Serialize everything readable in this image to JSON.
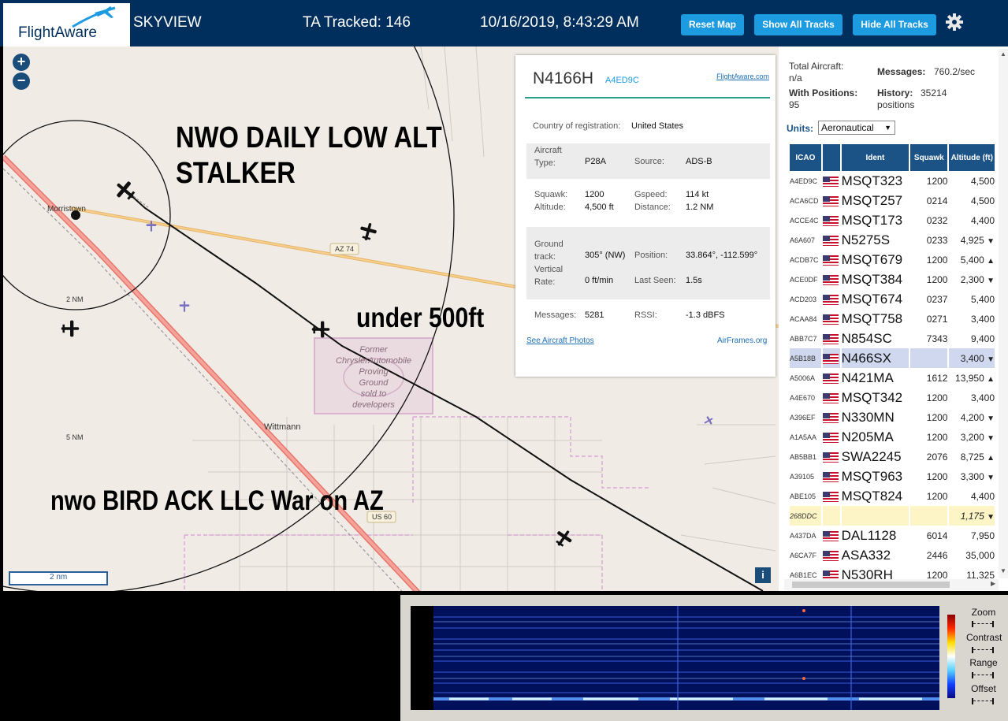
{
  "topbar": {
    "logo_text": "FlightAware",
    "app_name": "SKYVIEW",
    "tracked": "TA Tracked: 146",
    "datetime": "10/16/2019, 8:43:29 AM",
    "buttons": {
      "reset": "Reset Map",
      "show_all": "Show All Tracks",
      "hide_all": "Hide All Tracks"
    },
    "colors": {
      "bar": "#002f5d",
      "button": "#1c9be1"
    }
  },
  "map": {
    "zoom_in": "+",
    "zoom_out": "−",
    "annotations": {
      "line1": "NWO DAILY LOW ALT",
      "line2": "STALKER",
      "under": "under 500ft",
      "bottom": "nwo BIRD ACK LLC War on AZ"
    },
    "labels": {
      "morristown": "Morristown",
      "wittmann": "Wittmann",
      "az74": "AZ 74",
      "us60": "US 60",
      "ring2": "2 NM",
      "ring5": "5 NM",
      "proving": [
        "Former",
        "ChryslerAutomobile",
        "Proving",
        "Ground",
        "sold to",
        "developers"
      ]
    },
    "scale": "2 nm",
    "info": "i"
  },
  "popup": {
    "registration": "N4166H",
    "hex": "A4ED9C",
    "fa_link": "FlightAware.com",
    "country_label": "Country of registration:",
    "country_value": "United States",
    "aircraft_type_label": "Aircraft Type:",
    "aircraft_type_value": "P28A",
    "source_label": "Source:",
    "source_value": "ADS-B",
    "squawk_label": "Squawk:",
    "squawk_value": "1200",
    "altitude_label": "Altitude:",
    "altitude_value": "4,500 ft",
    "gspeed_label": "Gspeed:",
    "gspeed_value": "114 kt",
    "distance_label": "Distance:",
    "distance_value": "1.2 NM",
    "track_label": "Ground track:",
    "track_value": "305° (NW)",
    "position_label": "Position:",
    "position_value": "33.864°, -112.599°",
    "vrate_label": "Vertical Rate:",
    "vrate_value": "0 ft/min",
    "lastseen_label": "Last Seen:",
    "lastseen_value": "1.5s",
    "messages_label": "Messages:",
    "messages_value": "5281",
    "rssi_label": "RSSI:",
    "rssi_value": "-1.3 dBFS",
    "photos_link": "See Aircraft Photos",
    "airframes_link": "AirFrames.org"
  },
  "sidebar": {
    "total_aircraft_label": "Total Aircraft:",
    "total_aircraft_value": "n/a",
    "messages_label": "Messages:",
    "messages_value": "760.2/sec",
    "with_positions_label": "With Positions:",
    "with_positions_value": "95",
    "history_label": "History:",
    "history_value": "35214 positions",
    "units_label": "Units:",
    "units_value": "Aeronautical",
    "table": {
      "headers": [
        "ICAO",
        "Ident",
        "Squawk",
        "Altitude (ft)"
      ],
      "rows": [
        {
          "icao": "A4ED9C",
          "ident": "MSQT323",
          "squawk": "1200",
          "alt": "4,500",
          "trend": ""
        },
        {
          "icao": "ACA6CD",
          "ident": "MSQT257",
          "squawk": "0214",
          "alt": "4,500",
          "trend": ""
        },
        {
          "icao": "ACCE4C",
          "ident": "MSQT173",
          "squawk": "0232",
          "alt": "4,400",
          "trend": ""
        },
        {
          "icao": "A6A607",
          "ident": "N5275S",
          "squawk": "0233",
          "alt": "4,925",
          "trend": "▼"
        },
        {
          "icao": "ACDB7C",
          "ident": "MSQT679",
          "squawk": "1200",
          "alt": "5,400",
          "trend": "▲"
        },
        {
          "icao": "ACE0DF",
          "ident": "MSQT384",
          "squawk": "1200",
          "alt": "2,300",
          "trend": "▼"
        },
        {
          "icao": "ACD203",
          "ident": "MSQT674",
          "squawk": "0237",
          "alt": "5,400",
          "trend": ""
        },
        {
          "icao": "ACAA84",
          "ident": "MSQT758",
          "squawk": "0271",
          "alt": "3,400",
          "trend": ""
        },
        {
          "icao": "ABB7C7",
          "ident": "N854SC",
          "squawk": "7343",
          "alt": "9,400",
          "trend": ""
        },
        {
          "icao": "A5B18B",
          "ident": "N466SX",
          "squawk": "",
          "alt": "3,400",
          "trend": "▼"
        },
        {
          "icao": "A5006A",
          "ident": "N421MA",
          "squawk": "1612",
          "alt": "13,950",
          "trend": "▲"
        },
        {
          "icao": "A4E670",
          "ident": "MSQT342",
          "squawk": "1200",
          "alt": "3,400",
          "trend": ""
        },
        {
          "icao": "A396EF",
          "ident": "N330MN",
          "squawk": "1200",
          "alt": "4,200",
          "trend": "▼"
        },
        {
          "icao": "A1A5AA",
          "ident": "N205MA",
          "squawk": "1200",
          "alt": "3,200",
          "trend": "▼"
        },
        {
          "icao": "AB5BB1",
          "ident": "SWA2245",
          "squawk": "2076",
          "alt": "8,725",
          "trend": "▲"
        },
        {
          "icao": "A39105",
          "ident": "MSQT963",
          "squawk": "1200",
          "alt": "3,300",
          "trend": "▼"
        },
        {
          "icao": "ABE105",
          "ident": "MSQT824",
          "squawk": "1200",
          "alt": "4,400",
          "trend": ""
        },
        {
          "icao": "268DDC",
          "ident": "",
          "squawk": "",
          "alt": "1,175",
          "trend": "▼"
        },
        {
          "icao": "A437DA",
          "ident": "DAL1128",
          "squawk": "6014",
          "alt": "7,950",
          "trend": ""
        },
        {
          "icao": "A6CA7F",
          "ident": "ASA332",
          "squawk": "2446",
          "alt": "35,000",
          "trend": ""
        },
        {
          "icao": "A6B1EC",
          "ident": "N530RH",
          "squawk": "1200",
          "alt": "11,325",
          "trend": ""
        }
      ]
    }
  },
  "waterfall": {
    "controls": [
      "Zoom",
      "Contrast",
      "Range",
      "Offset"
    ]
  }
}
